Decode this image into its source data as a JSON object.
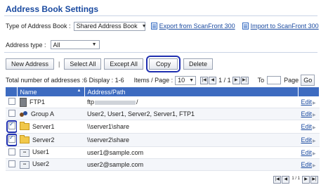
{
  "page": {
    "title": "Address Book Settings"
  },
  "header": {
    "type_label": "Type of Address Book :",
    "type_value": "Shared Address Book",
    "export_link": "Export from ScanFront 300",
    "import_link": "Import to ScanFront 300",
    "address_type_label": "Address type :",
    "address_type_value": "All"
  },
  "toolbar": {
    "new_address": "New Address",
    "separator": "|",
    "select_all": "Select All",
    "except_all": "Except All",
    "copy": "Copy",
    "delete": "Delete"
  },
  "pager": {
    "totals_text": "Total number of addresses :6 Display : 1-6",
    "items_label": "Items / Page :",
    "items_value": "10",
    "page_text": "1 / 1",
    "to_label": "To",
    "page_label": "Page",
    "go": "Go",
    "bottom_page_text": "1 / 1"
  },
  "table": {
    "headers": {
      "name": "Name",
      "path": "Address/Path",
      "sort_indicator": "▲"
    },
    "edit_label": "Edit",
    "rows": [
      {
        "name": "FTP1",
        "path_prefix": "ftp",
        "path_suffix": "/",
        "icon": "ftp-icon",
        "checked": false
      },
      {
        "name": "Group A",
        "path": "User2, User1, Server2, Server1, FTP1",
        "icon": "group-icon",
        "checked": false
      },
      {
        "name": "Server1",
        "path": "\\\\server1\\share",
        "icon": "folder-icon",
        "checked": true
      },
      {
        "name": "Server2",
        "path": "\\\\server2\\share",
        "icon": "folder-icon",
        "checked": true
      },
      {
        "name": "User1",
        "path": "user1@sample.com",
        "icon": "user-icon",
        "checked": false
      },
      {
        "name": "User2",
        "path": "user2@sample.com",
        "icon": "user-icon",
        "checked": false
      }
    ]
  },
  "colors": {
    "accent": "#1a4aa0",
    "header_bg": "#3d6bc0",
    "highlight_ring": "#1f2fb0"
  }
}
